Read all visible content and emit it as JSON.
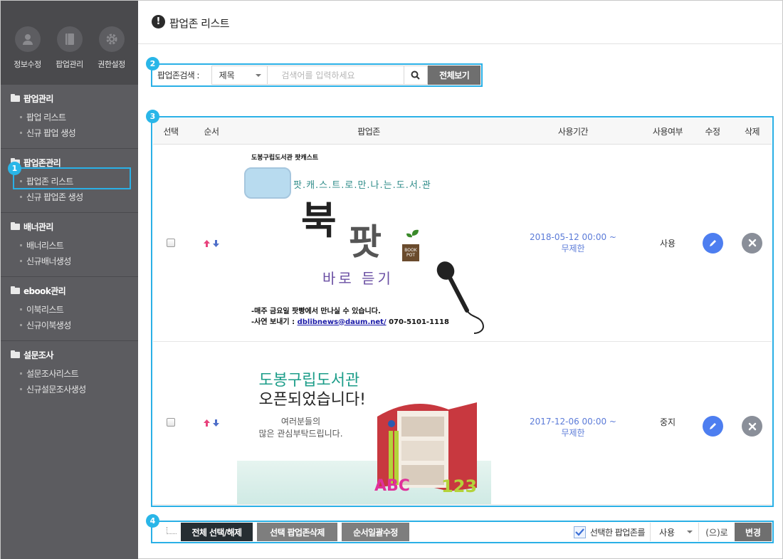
{
  "sidebar": {
    "quick": [
      {
        "label": "정보수정",
        "icon": "user-icon"
      },
      {
        "label": "팝업관리",
        "icon": "book-icon"
      },
      {
        "label": "권한설정",
        "icon": "gear-icon"
      }
    ],
    "sections": [
      {
        "title": "팝업관리",
        "items": [
          "팝업 리스트",
          "신규 팝업 생성"
        ]
      },
      {
        "title": "팝업존관리",
        "items": [
          "팝업존 리스트",
          "신규 팝업존 생성"
        ]
      },
      {
        "title": "배너관리",
        "items": [
          "배너리스트",
          "신규배너생성"
        ]
      },
      {
        "title": "ebook관리",
        "items": [
          "이북리스트",
          "신규이북생성"
        ]
      },
      {
        "title": "설문조사",
        "items": [
          "설문조사리스트",
          "신규설문조사생성"
        ]
      }
    ]
  },
  "page": {
    "title": "팝업존 리스트"
  },
  "badges": [
    "1",
    "2",
    "3",
    "4"
  ],
  "search": {
    "label": "팝업존검색 :",
    "field_value": "제목",
    "placeholder": "검색어를 입력하세요",
    "all_button": "전체보기"
  },
  "table": {
    "headers": {
      "select": "선택",
      "order": "순서",
      "zone": "팝업존",
      "period": "사용기간",
      "use": "사용여부",
      "edit": "수정",
      "delete": "삭제"
    },
    "rows": [
      {
        "period_start": "2018-05-12 00:00 ~",
        "period_end": "무제한",
        "use": "사용",
        "banner": {
          "title": "도봉구립도서관 팟캐스트",
          "slogan": "팟.캐.스.트.로.만.나.는.도.서.관",
          "big1": "북",
          "big2": "팟",
          "pot": "BOOK POT",
          "sub": "바로 듣기",
          "line1": "-매주 금요일 팟빵에서 만나실 수 있습니다.",
          "line2_prefix": "-사연 보내기 : ",
          "line2_email": "dblibnews@daum.net/",
          "line2_suffix": " 070-5101-1118"
        }
      },
      {
        "period_start": "2017-12-06 00:00 ~",
        "period_end": "무제한",
        "use": "중지",
        "banner": {
          "title": "도봉구립도서관",
          "subtitle": "오픈되었습니다!",
          "text1": "여러분들의",
          "text2": "많은 관심부탁드립니다."
        }
      }
    ]
  },
  "footer": {
    "select_all": "전체 선택/해제",
    "delete_selected": "선택 팝업존삭제",
    "order_bulk": "순서일괄수정",
    "apply_label": "선택한 팝업존를",
    "apply_value": "사용",
    "suffix": "(으)로",
    "change": "변경"
  },
  "colors": {
    "accent": "#29b6e8",
    "edit": "#4d7ef0",
    "period": "#5b7bd8"
  }
}
